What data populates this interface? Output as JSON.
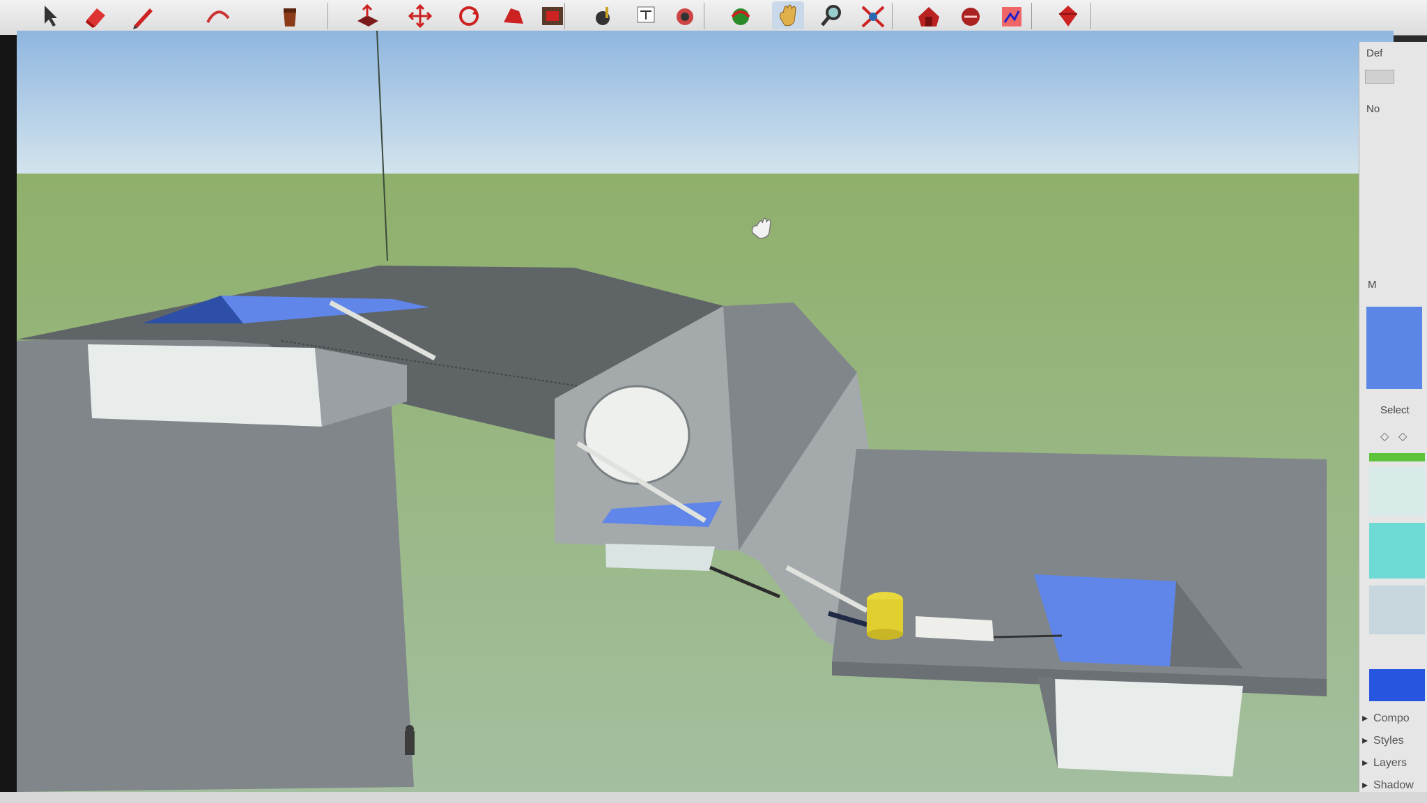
{
  "toolbar": {
    "tools": [
      {
        "name": "select-tool",
        "icon": "arrow-icon"
      },
      {
        "name": "eraser-tool",
        "icon": "eraser-icon"
      },
      {
        "name": "line-tool",
        "icon": "pencil-icon"
      },
      {
        "name": "arc-tool",
        "icon": "arc-icon"
      },
      {
        "name": "paint-bucket-tool",
        "icon": "paint-bucket-icon"
      },
      {
        "name": "push-pull-tool",
        "icon": "push-pull-icon"
      },
      {
        "name": "move-tool",
        "icon": "move-icon"
      },
      {
        "name": "rotate-tool",
        "icon": "rotate-icon"
      },
      {
        "name": "follow-me-tool",
        "icon": "follow-me-icon"
      },
      {
        "name": "offset-tool",
        "icon": "offset-icon"
      },
      {
        "name": "tape-measure-tool",
        "icon": "tape-measure-icon"
      },
      {
        "name": "text-tool",
        "icon": "text-icon"
      },
      {
        "name": "3d-text-tool",
        "icon": "3d-text-icon"
      },
      {
        "name": "orbit-tool",
        "icon": "orbit-icon"
      },
      {
        "name": "pan-tool",
        "icon": "hand-icon"
      },
      {
        "name": "zoom-tool",
        "icon": "magnifier-icon"
      },
      {
        "name": "zoom-extents-tool",
        "icon": "zoom-extents-icon"
      },
      {
        "name": "warehouse-tool",
        "icon": "warehouse-icon"
      },
      {
        "name": "share-model-tool",
        "icon": "share-model-icon"
      },
      {
        "name": "extension-tool",
        "icon": "extension-icon"
      },
      {
        "name": "ruby-console-tool",
        "icon": "ruby-icon"
      }
    ],
    "active_tool": "pan-tool"
  },
  "tray": {
    "default_tray_label": "Def",
    "material_name": "No",
    "materials_header": "M",
    "select_label": "Select",
    "swatch_colors": [
      "#5b86e6",
      "#d9ebe8",
      "#6fdad4",
      "#c7d7dd",
      "#2656e0"
    ],
    "panels": [
      "Compo",
      "Styles",
      "Layers",
      "Shadow"
    ]
  },
  "colors": {
    "sky_top": "#8fb6e0",
    "sky_bottom": "#d8e7ee",
    "ground": "#90b46f",
    "face_dark": "#5f6466",
    "face_mid": "#80868a",
    "face_light": "#a4a9ac",
    "face_white": "#e8ecea",
    "glass_blue": "#5f86e8",
    "cylinder_yellow": "#e0cf2e"
  }
}
